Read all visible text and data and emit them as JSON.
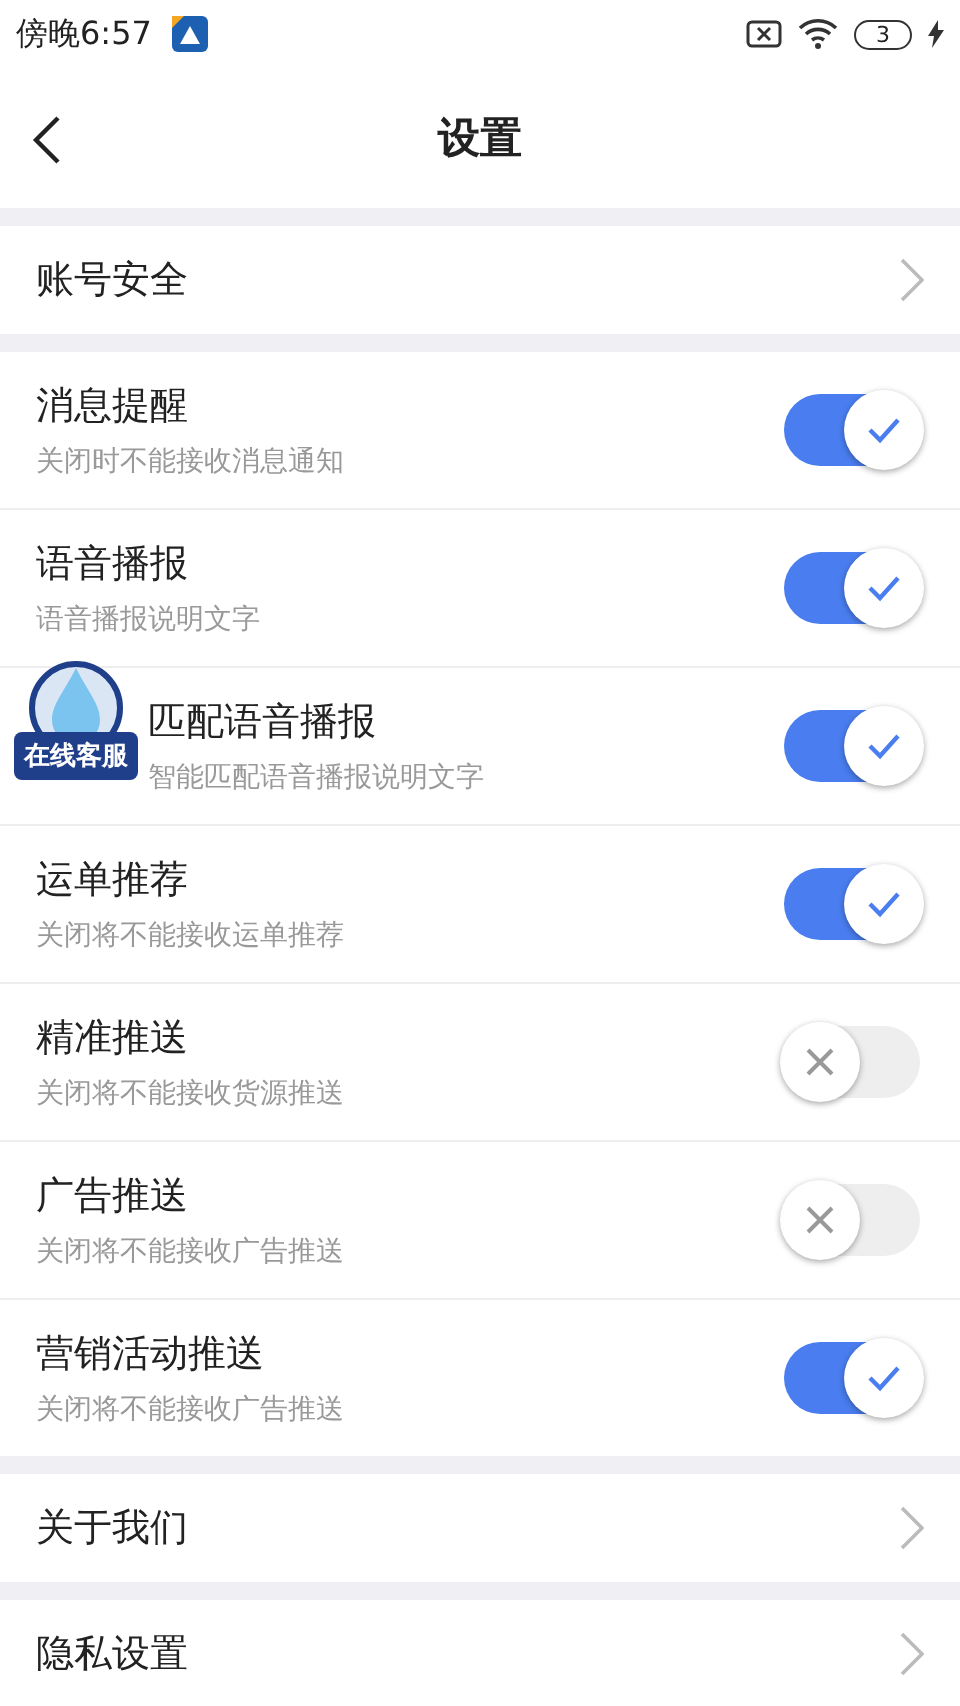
{
  "status_bar": {
    "time": "傍晚6:57",
    "battery": "3"
  },
  "header": {
    "title": "设置"
  },
  "sections": [
    {
      "kind": "links",
      "items": [
        {
          "title": "账号安全"
        }
      ]
    },
    {
      "kind": "toggles",
      "items": [
        {
          "title": "消息提醒",
          "subtitle": "关闭时不能接收消息通知",
          "on": true
        },
        {
          "title": "语音播报",
          "subtitle": "语音播报说明文字",
          "on": true
        },
        {
          "title": "匹配语音播报",
          "subtitle": "智能匹配语音播报说明文字",
          "on": true
        },
        {
          "title": "运单推荐",
          "subtitle": "关闭将不能接收运单推荐",
          "on": true
        },
        {
          "title": "精准推送",
          "subtitle": "关闭将不能接收货源推送",
          "on": false
        },
        {
          "title": "广告推送",
          "subtitle": "关闭将不能接收广告推送",
          "on": false
        },
        {
          "title": "营销活动推送",
          "subtitle": "关闭将不能接收广告推送",
          "on": true
        }
      ]
    },
    {
      "kind": "links",
      "items": [
        {
          "title": "关于我们"
        }
      ]
    },
    {
      "kind": "links",
      "items": [
        {
          "title": "隐私设置"
        }
      ]
    }
  ],
  "floating_badge": {
    "label": "在线客服"
  }
}
